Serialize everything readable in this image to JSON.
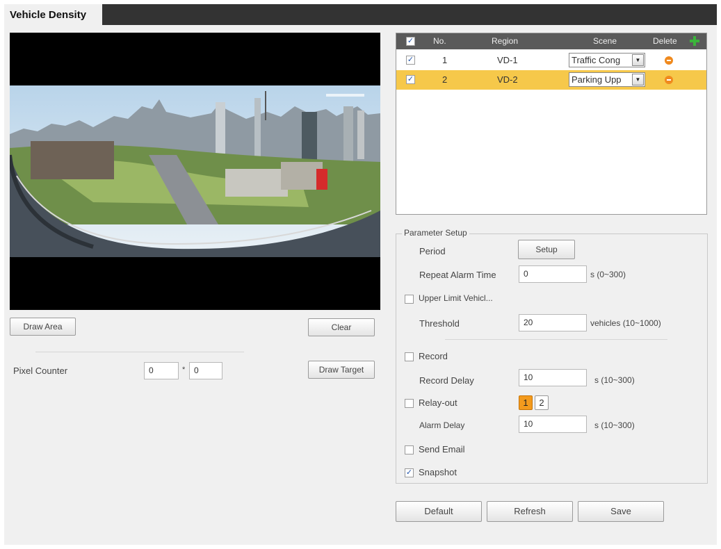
{
  "tab": {
    "title": "Vehicle Density"
  },
  "left": {
    "draw_area": "Draw Area",
    "clear": "Clear",
    "pixel_counter_label": "Pixel Counter",
    "pixel_w": "0",
    "pixel_sep": "*",
    "pixel_h": "0",
    "draw_target": "Draw Target"
  },
  "table": {
    "headers": {
      "no": "No.",
      "region": "Region",
      "scene": "Scene",
      "delete": "Delete"
    },
    "rows": [
      {
        "no": "1",
        "region": "VD-1",
        "scene": "Traffic Cong",
        "checked": true,
        "selected": false
      },
      {
        "no": "2",
        "region": "VD-2",
        "scene": "Parking Upp",
        "checked": true,
        "selected": true
      }
    ]
  },
  "params": {
    "group_title": "Parameter Setup",
    "period_label": "Period",
    "setup_button": "Setup",
    "repeat_alarm_label": "Repeat Alarm Time",
    "repeat_alarm_value": "0",
    "repeat_alarm_unit": "s (0~300)",
    "upper_limit_label": "Upper Limit Vehicl...",
    "threshold_label": "Threshold",
    "threshold_value": "20",
    "threshold_unit": "vehicles (10~1000)",
    "record_label": "Record",
    "record_delay_label": "Record Delay",
    "record_delay_value": "10",
    "record_delay_unit": "s (10~300)",
    "relay_label": "Relay-out",
    "relay_1": "1",
    "relay_2": "2",
    "alarm_delay_label": "Alarm Delay",
    "alarm_delay_value": "10",
    "alarm_delay_unit": "s (10~300)",
    "send_email_label": "Send Email",
    "snapshot_label": "Snapshot",
    "checkmark": "✓"
  },
  "footer": {
    "default": "Default",
    "refresh": "Refresh",
    "save": "Save"
  },
  "colors": {
    "tab_bar": "#333333",
    "selected_row": "#f6c84a",
    "relay_active": "#f39a1d",
    "add_icon": "#3bb43b",
    "delete_icon": "#f08a1e"
  }
}
